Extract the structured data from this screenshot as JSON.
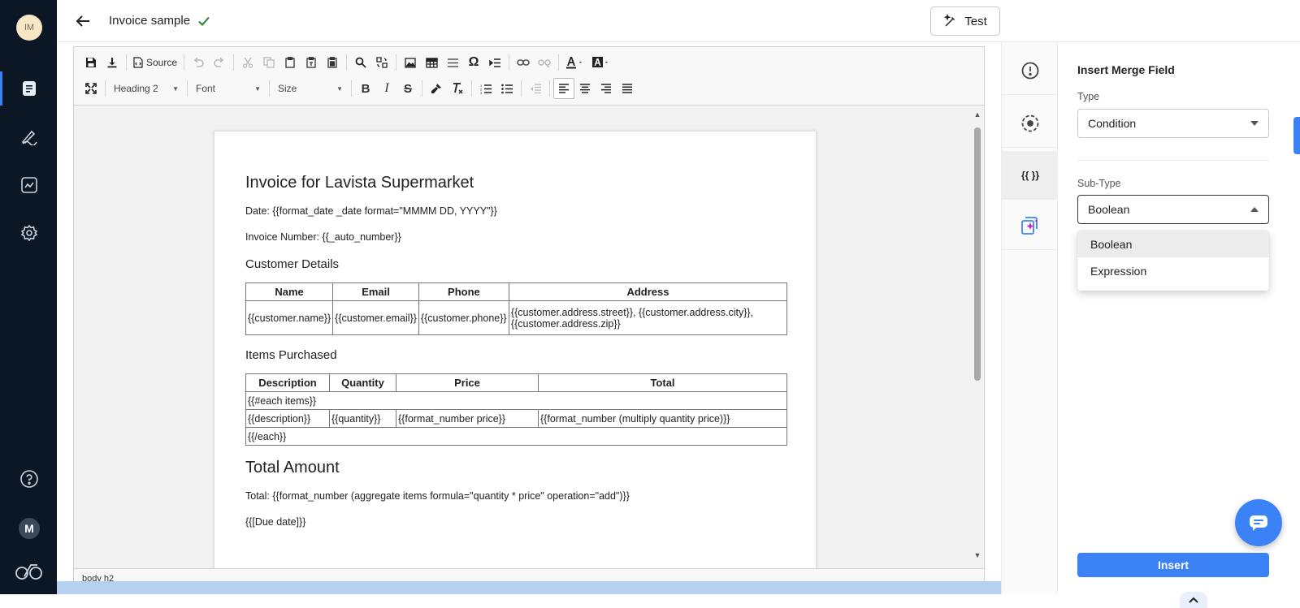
{
  "sidebar": {
    "avatar_initials": "IM",
    "user_initial": "M",
    "items": [
      {
        "icon": "document-icon"
      },
      {
        "icon": "signature-icon"
      },
      {
        "icon": "analytics-icon"
      },
      {
        "icon": "gear-icon"
      }
    ]
  },
  "header": {
    "title": "Invoice sample",
    "test_label": "Test"
  },
  "toolbar": {
    "source_label": "Source",
    "format_value": "Heading 2",
    "font_value": "Font",
    "size_value": "Size"
  },
  "document": {
    "heading": "Invoice for Lavista Supermarket",
    "date_line": "Date: {{format_date _date format=\"MMMM DD, YYYY\"}}",
    "invoice_number_line": "Invoice Number: {{_auto_number}}",
    "customer_heading": "Customer Details",
    "customer_table": {
      "headers": [
        "Name",
        "Email",
        "Phone",
        "Address"
      ],
      "row": [
        "{{customer.name}}",
        "{{customer.email}}",
        "{{customer.phone}}",
        "{{customer.address.street}}, {{customer.address.city}}, {{customer.address.zip}}"
      ]
    },
    "items_heading": "Items Purchased",
    "items_table": {
      "headers": [
        "Description",
        "Quantity",
        "Price",
        "Total"
      ],
      "each_open": "{{#each items}}",
      "row": [
        "{{description}}",
        "{{quantity}}",
        "{{format_number price}}",
        "{{format_number (multiply quantity price)}}"
      ],
      "each_close": "{{/each}}"
    },
    "total_heading": "Total Amount",
    "total_line": "Total: {{format_number (aggregate items formula=\"quantity * price\" operation=\"add\")}}",
    "due_line": "{{[Due date]}}"
  },
  "statusbar": {
    "path": "body   h2"
  },
  "panel": {
    "title": "Insert Merge Field",
    "type_label": "Type",
    "type_value": "Condition",
    "subtype_label": "Sub-Type",
    "subtype_value": "Boolean",
    "options": [
      "Boolean",
      "Expression"
    ],
    "insert_label": "Insert"
  },
  "colors": {
    "accent": "#3b82f6",
    "sidebar_bg": "#0b1724",
    "success": "#2e7d32"
  }
}
